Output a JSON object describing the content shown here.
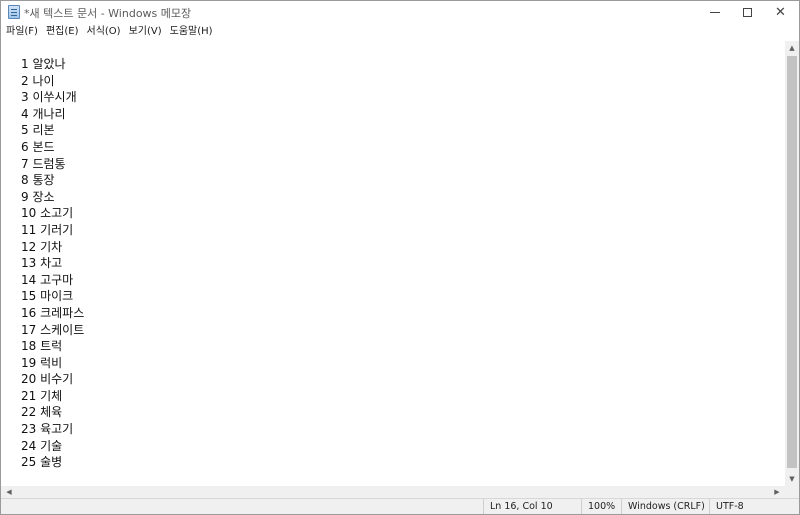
{
  "window": {
    "title": "*새 텍스트 문서 - Windows 메모장",
    "icon": "notepad-icon",
    "controls": {
      "minimize": "minimize-icon",
      "maximize": "maximize-icon",
      "close": "close-icon",
      "close_glyph": "✕"
    }
  },
  "menu": {
    "items": [
      "파일(F)",
      "편집(E)",
      "서식(O)",
      "보기(V)",
      "도움말(H)"
    ]
  },
  "editor": {
    "lines": [
      "1 알았나",
      "2 나이",
      "3 이쑤시개",
      "4 개나리",
      "5 리본",
      "6 본드",
      "7 드럼통",
      "8 통장",
      "9 장소",
      "10 소고기",
      "11 기러기",
      "12 기차",
      "13 차고",
      "14 고구마",
      "15 마이크",
      "16 크레파스",
      "17 스케이트",
      "18 트럭",
      "19 럭비",
      "20 비수기",
      "21 기체",
      "22 체육",
      "23 육고기",
      "24 기술",
      "25 술병"
    ]
  },
  "scrollbars": {
    "up_glyph": "▲",
    "down_glyph": "▼",
    "left_glyph": "◀",
    "right_glyph": "▶"
  },
  "status": {
    "position": "Ln 16, Col 10",
    "zoom": "100%",
    "line_ending": "Windows (CRLF)",
    "encoding": "UTF-8"
  },
  "colors": {
    "accent": "#5a86b8",
    "scroll_thumb": "#c2c2c2",
    "status_bg": "#f0f0f0"
  }
}
